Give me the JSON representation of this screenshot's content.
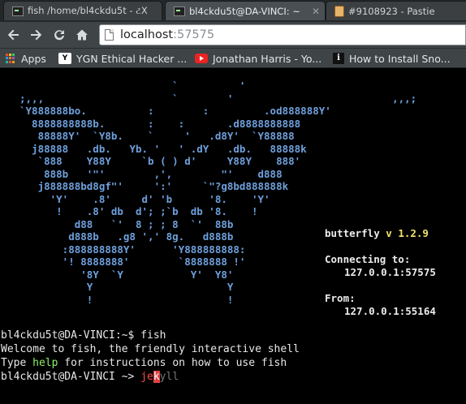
{
  "tabs": [
    {
      "label": "fish /home/bl4ckdu5t - ટX"
    },
    {
      "label": "bl4ckdu5t@DA-VINCI: ~"
    },
    {
      "label": "#9108923 - Pastie"
    }
  ],
  "toolbar": {
    "url_host": "localhost",
    "url_port": ":57575"
  },
  "bookmarks": [
    {
      "label": "Apps",
      "icon": "apps-grid-icon"
    },
    {
      "label": "YGN Ethical Hacker ...",
      "icon": "ygn-favicon"
    },
    {
      "label": "Jonathan Harris - Yo...",
      "icon": "youtube-icon"
    },
    {
      "label": "How to Install Sno...",
      "icon": "info-icon"
    }
  ],
  "butterfly": {
    "art_lines": [
      "                         `          '",
      ";,,,                     `        '                          ,,,;",
      "`Y888888bo.          :        :         .od888888Y'",
      "  8888888888b.       :    :       .d8888888888",
      "   88888Y'  `Y8b.    `     '   .d8Y'  `Y88888",
      "  j88888   .db.   Yb. '   ' .dY   .db.   88888k",
      "   `888    Y88Y     `b ( ) d'     Y88Y    888'",
      "    888b   '\"'        ,',        \"'    d888",
      "   j888888bd8gf\"'     ':'     `\"?g8bd888888k",
      "     'Y'    .8'     d' 'b      '8.    'Y'",
      "      !    .8' db  d'; ;`b  db '8.    !",
      "         d88   `'  8 ; ; 8  `'  88b",
      "        d888b   .g8 ',' 8g.   d888b",
      "       :888888888Y'      'Y888888888:",
      "       '! 8888888'        `8888888 !'",
      "          '8Y  `Y           Y'  Y8'",
      "           Y                      Y",
      "           !                      !"
    ],
    "name": "butterfly",
    "version": "v 1.2.9",
    "connecting_label": "Connecting to:",
    "connecting_addr": "127.0.0.1:57575",
    "from_label": "From:",
    "from_addr": "127.0.0.1:55164"
  },
  "shell": {
    "prompt1": "bl4ckdu5t@DA-VINCI:~$ fish",
    "welcome": "Welcome to fish, the friendly interactive shell",
    "help_pre": "Type ",
    "help_word": "help",
    "help_post": " for instructions on how to use fish",
    "prompt2": "bl4ckdu5t@DA-VINCI ~> ",
    "typed": "je",
    "cursor_char": "k",
    "suggestion": "yll"
  },
  "colors": {
    "butterfly_art": "#6fa0dc",
    "version": "#f1e36b",
    "address": "#8ff06a",
    "typed_command": "#ff4a4a",
    "suggestion": "#767676"
  }
}
